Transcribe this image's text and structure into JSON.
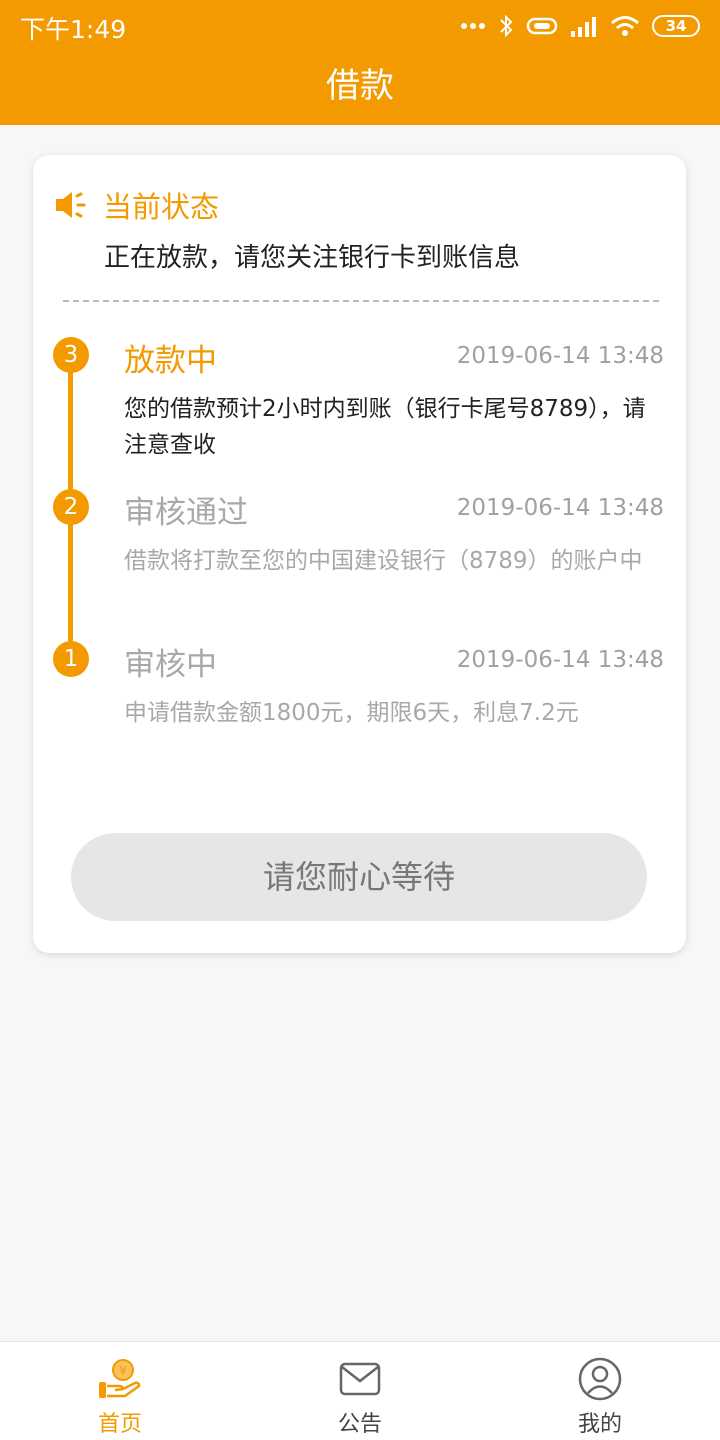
{
  "status_bar": {
    "time": "下午1:49",
    "battery": "34"
  },
  "header": {
    "title": "借款"
  },
  "status_card": {
    "heading": "当前状态",
    "message": "正在放款，请您关注银行卡到账信息"
  },
  "timeline": [
    {
      "number": "3",
      "title": "放款中",
      "time": "2019-06-14 13:48",
      "description": "您的借款预计2小时内到账（银行卡尾号8789），请注意查收",
      "state": "active"
    },
    {
      "number": "2",
      "title": "审核通过",
      "time": "2019-06-14 13:48",
      "description": "借款将打款至您的中国建设银行（8789）的账户中",
      "state": "inactive"
    },
    {
      "number": "1",
      "title": "审核中",
      "time": "2019-06-14 13:48",
      "description": "申请借款金额1800元，期限6天，利息7.2元",
      "state": "inactive"
    }
  ],
  "action": {
    "wait_label": "请您耐心等待"
  },
  "tabbar": {
    "items": [
      {
        "label": "首页",
        "icon": "hand-coin-icon",
        "active": true
      },
      {
        "label": "公告",
        "icon": "envelope-icon",
        "active": false
      },
      {
        "label": "我的",
        "icon": "user-circle-icon",
        "active": false
      }
    ]
  },
  "colors": {
    "accent": "#f39a00",
    "muted_text": "#a8a8a8",
    "button_bg": "#e6e6e6"
  }
}
